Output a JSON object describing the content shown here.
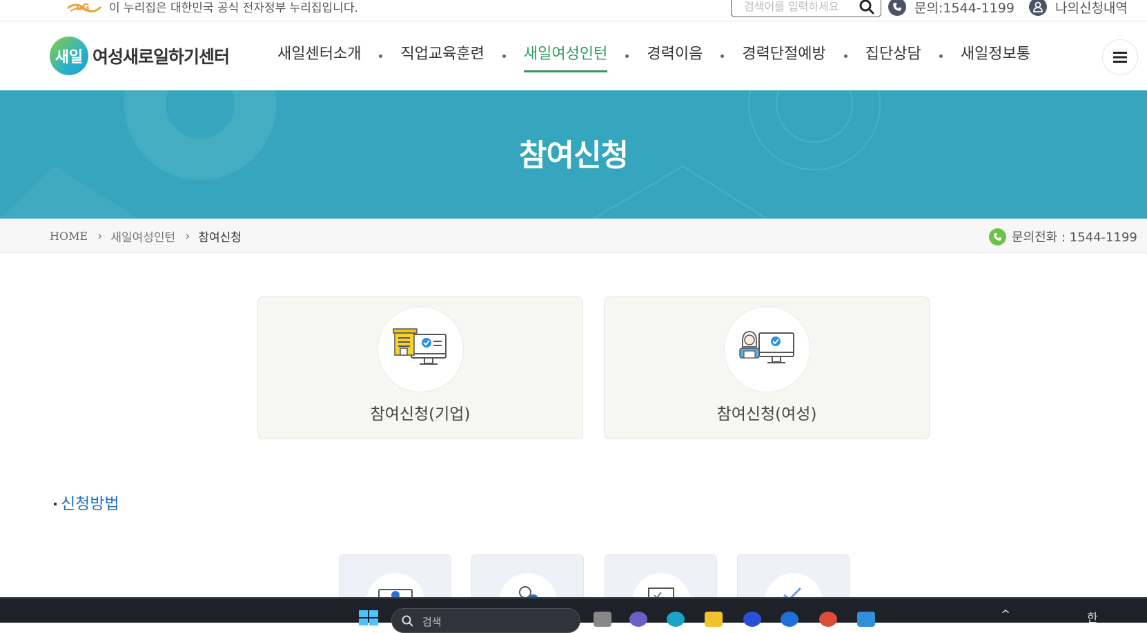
{
  "topbar": {
    "gov_notice": "이 누리집은 대한민국 공식 전자정부 누리집입니다.",
    "search_placeholder": "검색어를 입력하세요",
    "inquiry": "문의:1544-1199",
    "my_applications": "나의신청내역"
  },
  "header": {
    "logo_mark": "새일",
    "logo_text": "여성새로일하기센터",
    "nav": [
      {
        "label": "새일센터소개"
      },
      {
        "label": "직업교육훈련"
      },
      {
        "label": "새일여성인턴",
        "active": true
      },
      {
        "label": "경력이음"
      },
      {
        "label": "경력단절예방"
      },
      {
        "label": "집단상담"
      },
      {
        "label": "새일정보통"
      }
    ]
  },
  "banner": {
    "title": "참여신청",
    "color": "#35a6bd"
  },
  "breadcrumb": {
    "home": "HOME",
    "level1": "새일여성인턴",
    "current": "참여신청",
    "phone": "문의전화 : 1544-1199"
  },
  "cards": [
    {
      "label": "참여신청(기업)",
      "icon": "company-computer-icon"
    },
    {
      "label": "참여신청(여성)",
      "icon": "woman-computer-icon"
    }
  ],
  "section": {
    "title": "신청방법"
  },
  "taskbar": {
    "search_text": "검색",
    "ime": "한"
  },
  "colors": {
    "accent_green": "#2a9d60",
    "link_blue": "#1d6fc4",
    "banner_teal": "#35a6bd"
  }
}
